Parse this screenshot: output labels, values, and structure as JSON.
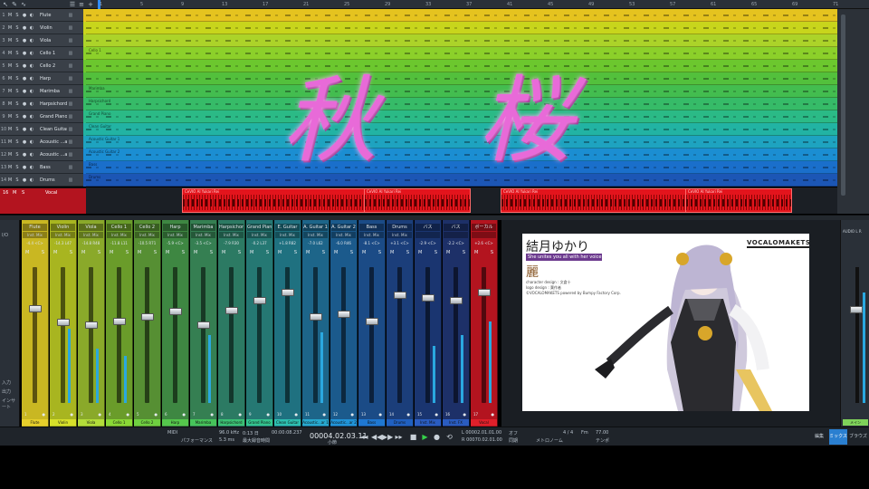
{
  "toolbar": {
    "icons": [
      "cursor-icon",
      "pencil-icon",
      "curve-icon",
      "list-icon",
      "menu-icon",
      "add-icon"
    ],
    "ruler_ticks": [
      "1",
      "5",
      "9",
      "13",
      "17",
      "21",
      "25",
      "29",
      "33",
      "37",
      "41",
      "45",
      "49",
      "53",
      "57",
      "61",
      "65",
      "69",
      "71"
    ]
  },
  "tracks": [
    {
      "num": "1",
      "name": "Flute",
      "color": "#e5c31f"
    },
    {
      "num": "2",
      "name": "Violin",
      "color": "#c8d51c"
    },
    {
      "num": "3",
      "name": "Viola",
      "color": "#acd329"
    },
    {
      "num": "4",
      "name": "Cello 1",
      "color": "#8cd02a",
      "clip": "Cello 1"
    },
    {
      "num": "5",
      "name": "Cello 2",
      "color": "#6cc72e"
    },
    {
      "num": "6",
      "name": "Harp",
      "color": "#53c03c"
    },
    {
      "num": "7",
      "name": "Marimba",
      "color": "#43bd4f",
      "clip": "Marimba"
    },
    {
      "num": "8",
      "name": "Harpsichord",
      "color": "#36bb68",
      "clip": "Harpsichord"
    },
    {
      "num": "9",
      "name": "Grand Piano",
      "color": "#2bba86",
      "clip": "Grand Piano"
    },
    {
      "num": "10",
      "name": "Clean Guitar",
      "color": "#22b3a3",
      "clip": "Clean Guitar"
    },
    {
      "num": "11",
      "name": "Acoustic ...ar 1",
      "color": "#1ea3c0",
      "clip": "Acoustic Guitar 1"
    },
    {
      "num": "12",
      "name": "Acoustic ...ar 2",
      "color": "#1b8ed2",
      "clip": "Acoustic Guitar 2"
    },
    {
      "num": "13",
      "name": "Bass",
      "color": "#1a6fcb",
      "clip": "Bass"
    },
    {
      "num": "14",
      "name": "Drums",
      "color": "#1c56b5",
      "clip": "Drums"
    }
  ],
  "vocal_track": {
    "num": "16",
    "name": "Vocal",
    "btn_m": "M",
    "btn_s": "S",
    "clips": [
      {
        "name": "CeVIO AI Yukari Rei"
      },
      {
        "name": "CeVIO AI Yukari Rei"
      },
      {
        "name": "CeVIO AI Yukari Rei"
      },
      {
        "name": "CeVIO AI Yukari Rei"
      }
    ]
  },
  "track_buttons": {
    "m": "M",
    "s": "S",
    "rec": "●",
    "mon": "◐"
  },
  "title_overlay": {
    "char1": "秋",
    "char2": "桜"
  },
  "mixer_left": {
    "labels": [
      "I/O",
      "入力",
      "出力",
      "インサート"
    ]
  },
  "channels": [
    {
      "name": "Flute",
      "inst": "Inst. Mix",
      "pan": "-4.4 <C>",
      "num": "1",
      "color": "#c9b722",
      "label_color": "#e6cf2b",
      "fader": 0.72,
      "meter": 0.0
    },
    {
      "name": "Violin",
      "inst": "Inst. Mix",
      "pan": "-14.3 L47",
      "num": "2",
      "color": "#a8b520",
      "label_color": "#d7e12a",
      "fader": 0.62,
      "meter": 0.55
    },
    {
      "name": "Viola",
      "inst": "Inst. Mix",
      "pan": "-14.8 R48",
      "num": "3",
      "color": "#8aa92a",
      "label_color": "#b3dd3a",
      "fader": 0.6,
      "meter": 0.4
    },
    {
      "name": "Cello 1",
      "inst": "Inst. Mix",
      "pan": "-11.8 L11",
      "num": "4",
      "color": "#6a9c2a",
      "label_color": "#8ad836",
      "fader": 0.63,
      "meter": 0.35
    },
    {
      "name": "Cello 2",
      "inst": "Inst. Mix",
      "pan": "-10.5 R71",
      "num": "5",
      "color": "#568f33",
      "label_color": "#6fd040",
      "fader": 0.66,
      "meter": 0.0
    },
    {
      "name": "Harp",
      "inst": "Inst. Mix",
      "pan": "-5.9 <C>",
      "num": "6",
      "color": "#3e8742",
      "label_color": "#55c74c",
      "fader": 0.7,
      "meter": 0.0
    },
    {
      "name": "Marimba",
      "inst": "Inst. Mix",
      "pan": "-3.5 <C>",
      "num": "7",
      "color": "#357f52",
      "label_color": "#46c45a",
      "fader": 0.6,
      "meter": 0.5
    },
    {
      "name": "Harpsichord",
      "inst": "Inst. Mix",
      "pan": "-7.9 R30",
      "num": "8",
      "color": "#2c7a63",
      "label_color": "#3bc174",
      "fader": 0.71,
      "meter": 0.0
    },
    {
      "name": "Grand Piano",
      "inst": "Inst. Mix",
      "pan": "-0.2 L37",
      "num": "9",
      "color": "#257873",
      "label_color": "#33c48e",
      "fader": 0.78,
      "meter": 0.0
    },
    {
      "name": "E. Guitar",
      "inst": "Inst. Mix",
      "pan": "+1.8 R82",
      "num": "10",
      "color": "#1f7180",
      "label_color": "#2dbfb0",
      "fader": 0.84,
      "meter": 0.0
    },
    {
      "name": "A. Guitar 1",
      "inst": "Inst. Mix",
      "pan": "-7.0 L62",
      "num": "11",
      "color": "#1d6589",
      "label_color": "#27a9cf",
      "fader": 0.66,
      "meter": 0.52
    },
    {
      "name": "A. Guitar 2",
      "inst": "Inst. Mix",
      "pan": "-6.0 R46",
      "num": "12",
      "color": "#1b5a8c",
      "label_color": "#2094d8",
      "fader": 0.68,
      "meter": 0.0
    },
    {
      "name": "Bass",
      "inst": "Inst. Mix",
      "pan": "-8.1 <C>",
      "num": "13",
      "color": "#1b4b86",
      "label_color": "#1f78d2",
      "fader": 0.63,
      "meter": 0.0
    },
    {
      "name": "Drums",
      "inst": "Inst. Mix",
      "pan": "+3.1 <C>",
      "num": "14",
      "color": "#1b3e7a",
      "label_color": "#2060c0",
      "fader": 0.82,
      "meter": 0.0
    },
    {
      "name": "バス",
      "inst": "",
      "pan": "-2.9 <C>",
      "num": "15",
      "color": "#1a3570",
      "label_color": "#2a5cc0",
      "fader": 0.8,
      "meter": 0.42
    },
    {
      "name": "バス",
      "inst": "",
      "pan": "-2.2 <C>",
      "num": "16",
      "color": "#1d3068",
      "label_color": "#2a5cc0",
      "fader": 0.78,
      "meter": 0.5
    },
    {
      "name": "ボーカル",
      "inst": "",
      "pan": "+2.6 <C>",
      "num": "17",
      "color": "#b3141f",
      "label_color": "#e0202a",
      "fader": 0.84,
      "meter": 0.6
    }
  ],
  "channel_footer_labels": [
    "Flute",
    "Violin",
    "Viola",
    "Cello 1",
    "Cello 2",
    "Harp",
    "Marimba",
    "Harpsichord",
    "Grand Piano",
    "Clean Guitar",
    "Acoustic...ar 1",
    "Acoustic...ar 2",
    "Bass",
    "Drums",
    "Inst. Mix",
    "Inst. FX",
    "Vocal"
  ],
  "video": {
    "name": "結月ゆかり",
    "tagline": "She unites you all with her voice",
    "kanji": "麗",
    "credits": [
      "character design : 文倉十",
      "logo design : 葉作者",
      "©VOCALOMAKETS powered by Bumpy Factory Corp."
    ],
    "brand": "VOCALOMAKETS"
  },
  "mixer_right": {
    "label": "AUDIO L R",
    "foot": "メイン"
  },
  "transport": {
    "midi_label": "MIDI",
    "perf_label": "パフォーマンス",
    "sample_rate": "96.0 kHz",
    "latency": "5.3 ms",
    "duration": "0:13 日",
    "duration_label": "最大録音時間",
    "time": "00:00:08.237",
    "bars": "00004.02.03.11",
    "bars_label": "小節",
    "loop_l": "L 00002.01.01.00",
    "loop_r": "R 00070.02.01.00",
    "punch": "オフ",
    "sync": "同期",
    "metronome": "メトロノーム",
    "timesig": "4 / 4",
    "key": "Fm",
    "tempo": "77.00",
    "tempo_label": "テンポ",
    "mode_buttons": [
      "編集",
      "ミックス",
      "ブラウズ"
    ],
    "active_mode": "ミックス"
  }
}
